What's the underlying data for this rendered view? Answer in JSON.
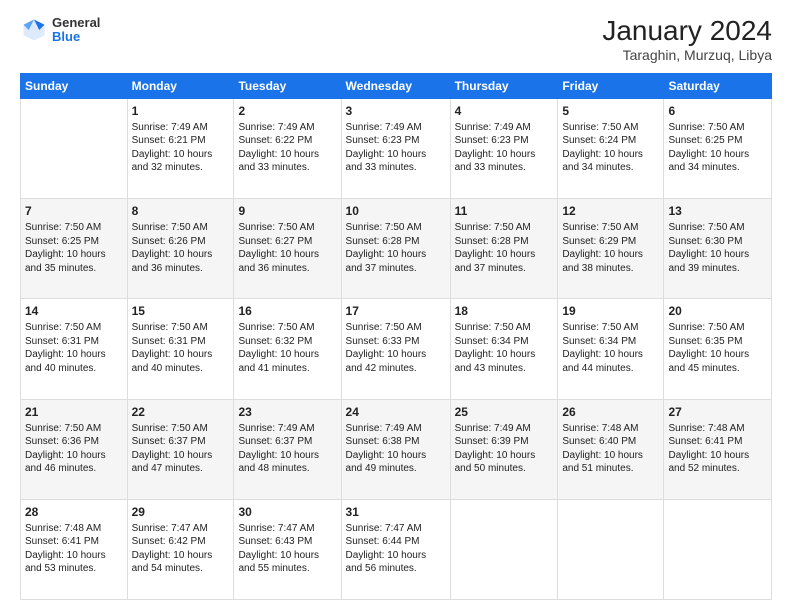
{
  "header": {
    "logo_general": "General",
    "logo_blue": "Blue",
    "title": "January 2024",
    "subtitle": "Taraghin, Murzuq, Libya"
  },
  "days_of_week": [
    "Sunday",
    "Monday",
    "Tuesday",
    "Wednesday",
    "Thursday",
    "Friday",
    "Saturday"
  ],
  "weeks": [
    [
      {
        "day": "",
        "empty": true
      },
      {
        "day": "1",
        "sunrise": "Sunrise: 7:49 AM",
        "sunset": "Sunset: 6:21 PM",
        "daylight": "Daylight: 10 hours and 32 minutes."
      },
      {
        "day": "2",
        "sunrise": "Sunrise: 7:49 AM",
        "sunset": "Sunset: 6:22 PM",
        "daylight": "Daylight: 10 hours and 33 minutes."
      },
      {
        "day": "3",
        "sunrise": "Sunrise: 7:49 AM",
        "sunset": "Sunset: 6:23 PM",
        "daylight": "Daylight: 10 hours and 33 minutes."
      },
      {
        "day": "4",
        "sunrise": "Sunrise: 7:49 AM",
        "sunset": "Sunset: 6:23 PM",
        "daylight": "Daylight: 10 hours and 33 minutes."
      },
      {
        "day": "5",
        "sunrise": "Sunrise: 7:50 AM",
        "sunset": "Sunset: 6:24 PM",
        "daylight": "Daylight: 10 hours and 34 minutes."
      },
      {
        "day": "6",
        "sunrise": "Sunrise: 7:50 AM",
        "sunset": "Sunset: 6:25 PM",
        "daylight": "Daylight: 10 hours and 34 minutes."
      }
    ],
    [
      {
        "day": "7",
        "sunrise": "Sunrise: 7:50 AM",
        "sunset": "Sunset: 6:25 PM",
        "daylight": "Daylight: 10 hours and 35 minutes."
      },
      {
        "day": "8",
        "sunrise": "Sunrise: 7:50 AM",
        "sunset": "Sunset: 6:26 PM",
        "daylight": "Daylight: 10 hours and 36 minutes."
      },
      {
        "day": "9",
        "sunrise": "Sunrise: 7:50 AM",
        "sunset": "Sunset: 6:27 PM",
        "daylight": "Daylight: 10 hours and 36 minutes."
      },
      {
        "day": "10",
        "sunrise": "Sunrise: 7:50 AM",
        "sunset": "Sunset: 6:28 PM",
        "daylight": "Daylight: 10 hours and 37 minutes."
      },
      {
        "day": "11",
        "sunrise": "Sunrise: 7:50 AM",
        "sunset": "Sunset: 6:28 PM",
        "daylight": "Daylight: 10 hours and 37 minutes."
      },
      {
        "day": "12",
        "sunrise": "Sunrise: 7:50 AM",
        "sunset": "Sunset: 6:29 PM",
        "daylight": "Daylight: 10 hours and 38 minutes."
      },
      {
        "day": "13",
        "sunrise": "Sunrise: 7:50 AM",
        "sunset": "Sunset: 6:30 PM",
        "daylight": "Daylight: 10 hours and 39 minutes."
      }
    ],
    [
      {
        "day": "14",
        "sunrise": "Sunrise: 7:50 AM",
        "sunset": "Sunset: 6:31 PM",
        "daylight": "Daylight: 10 hours and 40 minutes."
      },
      {
        "day": "15",
        "sunrise": "Sunrise: 7:50 AM",
        "sunset": "Sunset: 6:31 PM",
        "daylight": "Daylight: 10 hours and 40 minutes."
      },
      {
        "day": "16",
        "sunrise": "Sunrise: 7:50 AM",
        "sunset": "Sunset: 6:32 PM",
        "daylight": "Daylight: 10 hours and 41 minutes."
      },
      {
        "day": "17",
        "sunrise": "Sunrise: 7:50 AM",
        "sunset": "Sunset: 6:33 PM",
        "daylight": "Daylight: 10 hours and 42 minutes."
      },
      {
        "day": "18",
        "sunrise": "Sunrise: 7:50 AM",
        "sunset": "Sunset: 6:34 PM",
        "daylight": "Daylight: 10 hours and 43 minutes."
      },
      {
        "day": "19",
        "sunrise": "Sunrise: 7:50 AM",
        "sunset": "Sunset: 6:34 PM",
        "daylight": "Daylight: 10 hours and 44 minutes."
      },
      {
        "day": "20",
        "sunrise": "Sunrise: 7:50 AM",
        "sunset": "Sunset: 6:35 PM",
        "daylight": "Daylight: 10 hours and 45 minutes."
      }
    ],
    [
      {
        "day": "21",
        "sunrise": "Sunrise: 7:50 AM",
        "sunset": "Sunset: 6:36 PM",
        "daylight": "Daylight: 10 hours and 46 minutes."
      },
      {
        "day": "22",
        "sunrise": "Sunrise: 7:50 AM",
        "sunset": "Sunset: 6:37 PM",
        "daylight": "Daylight: 10 hours and 47 minutes."
      },
      {
        "day": "23",
        "sunrise": "Sunrise: 7:49 AM",
        "sunset": "Sunset: 6:37 PM",
        "daylight": "Daylight: 10 hours and 48 minutes."
      },
      {
        "day": "24",
        "sunrise": "Sunrise: 7:49 AM",
        "sunset": "Sunset: 6:38 PM",
        "daylight": "Daylight: 10 hours and 49 minutes."
      },
      {
        "day": "25",
        "sunrise": "Sunrise: 7:49 AM",
        "sunset": "Sunset: 6:39 PM",
        "daylight": "Daylight: 10 hours and 50 minutes."
      },
      {
        "day": "26",
        "sunrise": "Sunrise: 7:48 AM",
        "sunset": "Sunset: 6:40 PM",
        "daylight": "Daylight: 10 hours and 51 minutes."
      },
      {
        "day": "27",
        "sunrise": "Sunrise: 7:48 AM",
        "sunset": "Sunset: 6:41 PM",
        "daylight": "Daylight: 10 hours and 52 minutes."
      }
    ],
    [
      {
        "day": "28",
        "sunrise": "Sunrise: 7:48 AM",
        "sunset": "Sunset: 6:41 PM",
        "daylight": "Daylight: 10 hours and 53 minutes."
      },
      {
        "day": "29",
        "sunrise": "Sunrise: 7:47 AM",
        "sunset": "Sunset: 6:42 PM",
        "daylight": "Daylight: 10 hours and 54 minutes."
      },
      {
        "day": "30",
        "sunrise": "Sunrise: 7:47 AM",
        "sunset": "Sunset: 6:43 PM",
        "daylight": "Daylight: 10 hours and 55 minutes."
      },
      {
        "day": "31",
        "sunrise": "Sunrise: 7:47 AM",
        "sunset": "Sunset: 6:44 PM",
        "daylight": "Daylight: 10 hours and 56 minutes."
      },
      {
        "day": "",
        "empty": true
      },
      {
        "day": "",
        "empty": true
      },
      {
        "day": "",
        "empty": true
      }
    ]
  ]
}
